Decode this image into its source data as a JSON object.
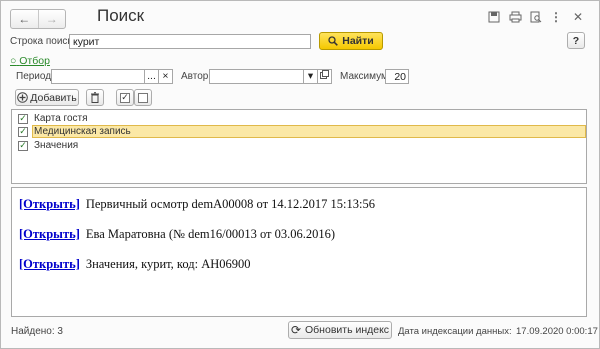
{
  "window": {
    "title": "Поиск",
    "back_icon": "arrow-left-icon",
    "forward_icon": "arrow-right-icon",
    "toolbar_icons": [
      "save-icon",
      "print-icon",
      "preview-icon",
      "more-icon",
      "close-icon"
    ]
  },
  "search": {
    "label": "Строка поиска:",
    "value": "курит",
    "find_label": "Найти",
    "help_label": "?"
  },
  "filter": {
    "link_label": "Отбор",
    "period_label": "Период:",
    "period_value": "",
    "period_choose": "...",
    "period_clear": "×",
    "author_label": "Автор:",
    "author_value": "",
    "author_dropdown": "▾",
    "max_label": "Максимум:",
    "max_value": "20"
  },
  "list_toolbar": {
    "add_label": "Добавить"
  },
  "object_types": [
    {
      "label": "Карта гостя",
      "checked": true
    },
    {
      "label": "Медицинская запись",
      "checked": true,
      "selected": true
    },
    {
      "label": "Значения",
      "checked": true
    }
  ],
  "results": [
    {
      "link": "[Открыть]",
      "text": "Первичный осмотр demA00008 от 14.12.2017 15:13:56"
    },
    {
      "link": "[Открыть]",
      "text": "Ева Маратовна (№ dem16/00013 от 03.06.2016)"
    },
    {
      "link": "[Открыть]",
      "text": "Значения, курит, код: АН06900"
    }
  ],
  "footer": {
    "found_label": "Найдено: 3",
    "update_index_label": "Обновить индекс",
    "index_date_label": "Дата индексации данных:",
    "index_date_value": "17.09.2020 0:00:17"
  }
}
